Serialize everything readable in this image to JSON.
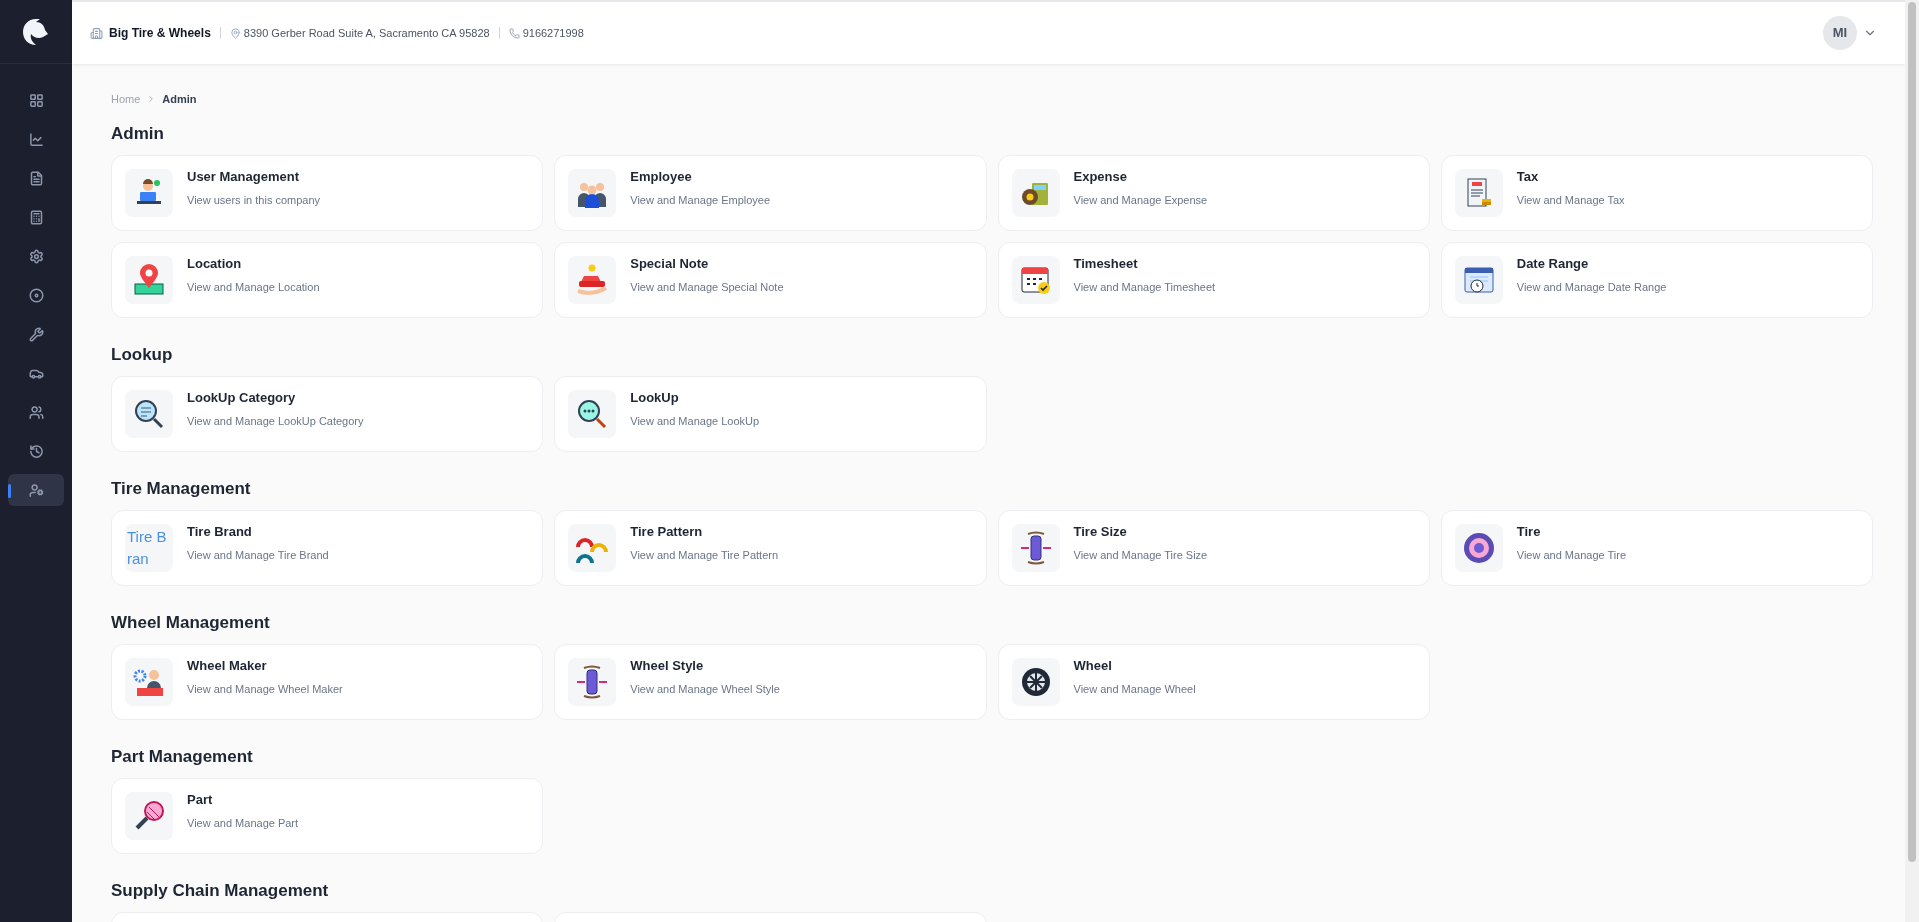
{
  "sidebar": {
    "items": [
      {
        "selected": false
      },
      {
        "selected": false
      },
      {
        "selected": false
      },
      {
        "selected": false
      },
      {
        "selected": false
      },
      {
        "selected": false
      },
      {
        "selected": false
      },
      {
        "selected": false
      },
      {
        "selected": false
      },
      {
        "selected": false
      },
      {
        "selected": true
      }
    ]
  },
  "header": {
    "company": "Big Tire & Wheels",
    "address": "8390 Gerber Road Suite A, Sacramento CA 95828",
    "phone": "9166271998",
    "avatar": "MI"
  },
  "breadcrumb": [
    "Home",
    "Admin"
  ],
  "sections": [
    {
      "title": "Admin",
      "cards": [
        {
          "title": "User Management",
          "subtitle": "View users in this company"
        },
        {
          "title": "Employee",
          "subtitle": "View and Manage Employee"
        },
        {
          "title": "Expense",
          "subtitle": "View and Manage Expense"
        },
        {
          "title": "Tax",
          "subtitle": "View and Manage Tax"
        },
        {
          "title": "Location",
          "subtitle": "View and Manage Location"
        },
        {
          "title": "Special Note",
          "subtitle": "View and Manage Special Note"
        },
        {
          "title": "Timesheet",
          "subtitle": "View and Manage Timesheet"
        },
        {
          "title": "Date Range",
          "subtitle": "View and Manage Date Range"
        }
      ]
    },
    {
      "title": "Lookup",
      "cards": [
        {
          "title": "LookUp Category",
          "subtitle": "View and Manage LookUp Category"
        },
        {
          "title": "LookUp",
          "subtitle": "View and Manage LookUp"
        }
      ]
    },
    {
      "title": "Tire Management",
      "cards": [
        {
          "title": "Tire Brand",
          "subtitle": "View and Manage Tire Brand",
          "image_alt": "Tire Bran"
        },
        {
          "title": "Tire Pattern",
          "subtitle": "View and Manage Tire Pattern"
        },
        {
          "title": "Tire Size",
          "subtitle": "View and Manage Tire Size"
        },
        {
          "title": "Tire",
          "subtitle": "View and Manage Tire"
        }
      ]
    },
    {
      "title": "Wheel Management",
      "cards": [
        {
          "title": "Wheel Maker",
          "subtitle": "View and Manage Wheel Maker"
        },
        {
          "title": "Wheel Style",
          "subtitle": "View and Manage Wheel Style"
        },
        {
          "title": "Wheel",
          "subtitle": "View and Manage Wheel"
        }
      ]
    },
    {
      "title": "Part Management",
      "cards": [
        {
          "title": "Part",
          "subtitle": "View and Manage Part"
        }
      ]
    },
    {
      "title": "Supply Chain Management"
    }
  ]
}
